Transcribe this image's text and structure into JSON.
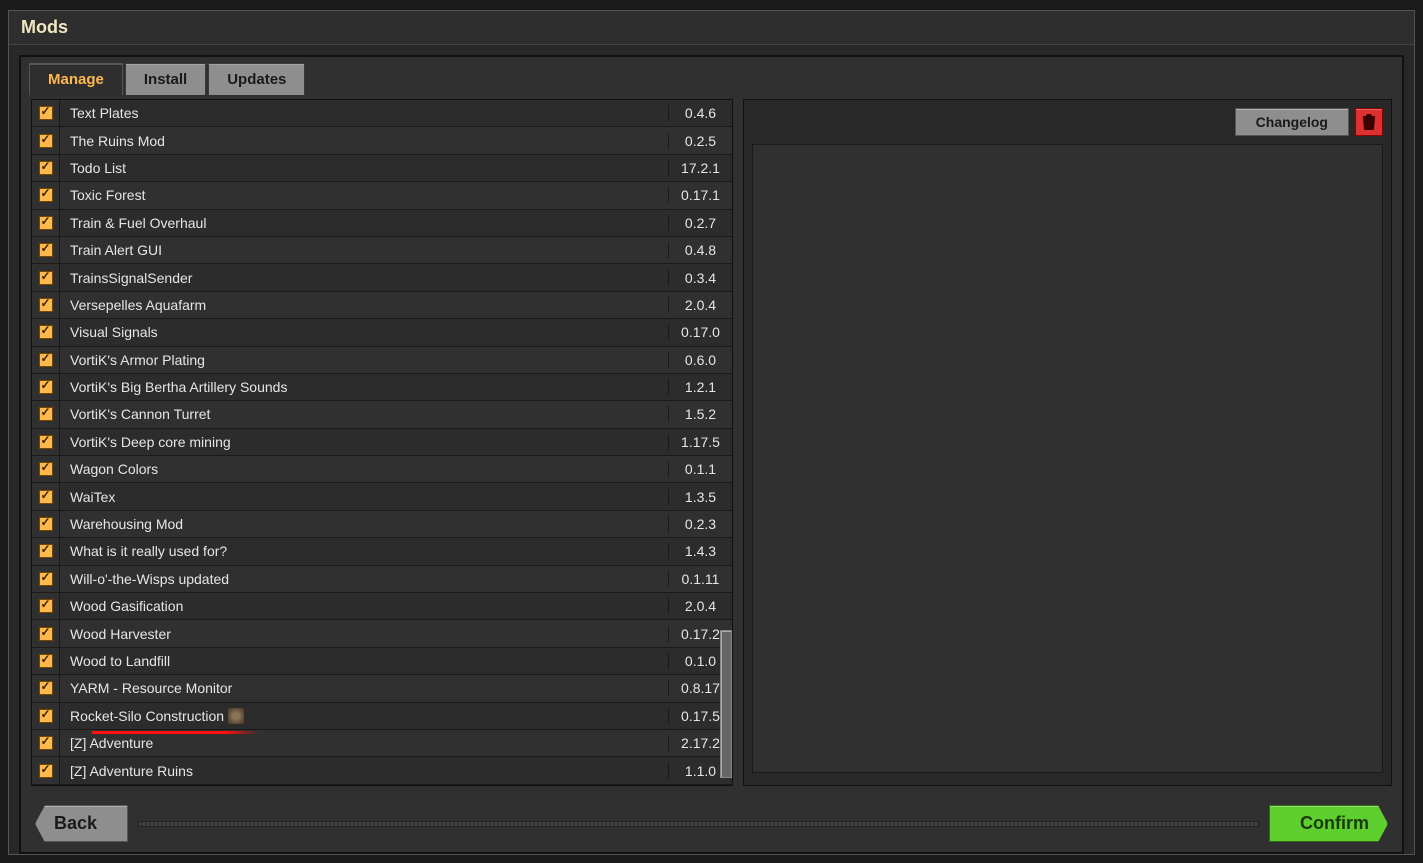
{
  "window": {
    "title": "Mods"
  },
  "tabs": {
    "manage": "Manage",
    "install": "Install",
    "updates": "Updates"
  },
  "detail": {
    "changelog": "Changelog"
  },
  "footer": {
    "back": "Back",
    "confirm": "Confirm"
  },
  "mods": [
    {
      "name": "Text Plates",
      "version": "0.4.6",
      "enabled": true
    },
    {
      "name": "The Ruins Mod",
      "version": "0.2.5",
      "enabled": true
    },
    {
      "name": "Todo List",
      "version": "17.2.1",
      "enabled": true
    },
    {
      "name": "Toxic Forest",
      "version": "0.17.1",
      "enabled": true
    },
    {
      "name": "Train & Fuel Overhaul",
      "version": "0.2.7",
      "enabled": true
    },
    {
      "name": "Train Alert GUI",
      "version": "0.4.8",
      "enabled": true
    },
    {
      "name": "TrainsSignalSender",
      "version": "0.3.4",
      "enabled": true
    },
    {
      "name": "Versepelles Aquafarm",
      "version": "2.0.4",
      "enabled": true
    },
    {
      "name": "Visual Signals",
      "version": "0.17.0",
      "enabled": true
    },
    {
      "name": "VortiK's Armor Plating",
      "version": "0.6.0",
      "enabled": true
    },
    {
      "name": "VortiK's Big Bertha Artillery Sounds",
      "version": "1.2.1",
      "enabled": true
    },
    {
      "name": "VortiK's Cannon Turret",
      "version": "1.5.2",
      "enabled": true
    },
    {
      "name": "VortiK's Deep core mining",
      "version": "1.17.5",
      "enabled": true
    },
    {
      "name": "Wagon Colors",
      "version": "0.1.1",
      "enabled": true
    },
    {
      "name": "WaiTex",
      "version": "1.3.5",
      "enabled": true
    },
    {
      "name": "Warehousing Mod",
      "version": "0.2.3",
      "enabled": true
    },
    {
      "name": "What is it really used for?",
      "version": "1.4.3",
      "enabled": true
    },
    {
      "name": "Will-o'-the-Wisps updated",
      "version": "0.1.11",
      "enabled": true
    },
    {
      "name": "Wood Gasification",
      "version": "2.0.4",
      "enabled": true
    },
    {
      "name": "Wood Harvester",
      "version": "0.17.2",
      "enabled": true
    },
    {
      "name": "Wood to Landfill",
      "version": "0.1.0",
      "enabled": true
    },
    {
      "name": "YARM - Resource Monitor",
      "version": "0.8.17",
      "enabled": true
    },
    {
      "name": "Rocket-Silo Construction",
      "version": "0.17.5",
      "enabled": true,
      "icon": true
    },
    {
      "name": "[Z] Adventure",
      "version": "2.17.2",
      "enabled": true
    },
    {
      "name": "[Z] Adventure Ruins",
      "version": "1.1.0",
      "enabled": true
    }
  ]
}
